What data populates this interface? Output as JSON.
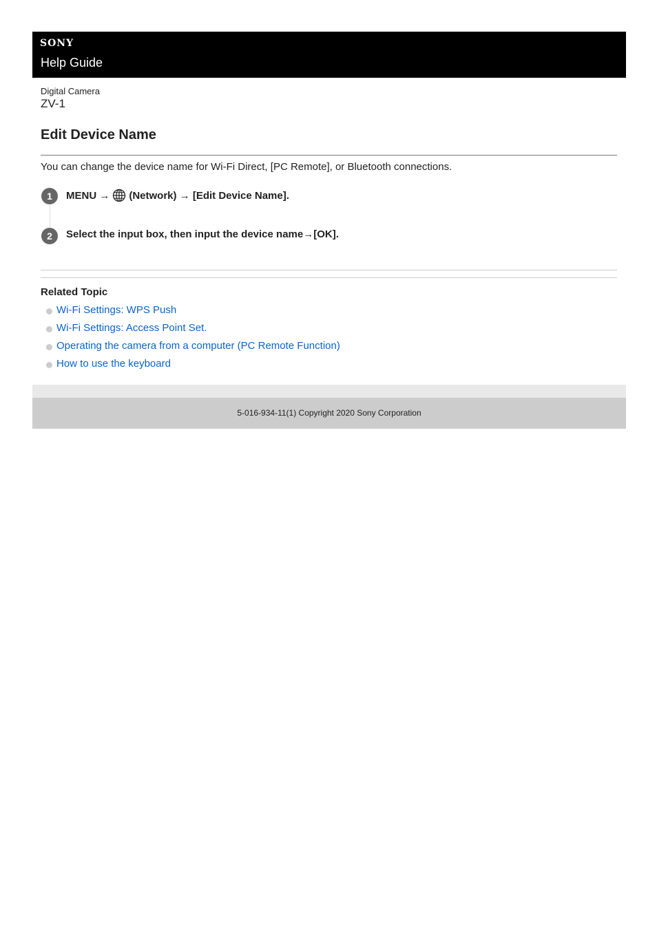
{
  "header": {
    "brand": "SONY",
    "guide_label": "Help Guide"
  },
  "product": {
    "type": "Digital Camera",
    "model": "ZV-1"
  },
  "article": {
    "title": "Edit Device Name",
    "intro": "You can change the device name for Wi-Fi Direct, [PC Remote], or Bluetooth connections.",
    "steps": [
      {
        "number": "1",
        "text_before_icon": "MENU →",
        "icon": "network-globe-icon",
        "text_after_icon": "(Network) → [Edit Device Name]."
      },
      {
        "number": "2",
        "text": "Select the input box, then input the device name→[OK]."
      }
    ]
  },
  "related": {
    "title": "Related Topic",
    "links": [
      {
        "label": "Wi-Fi Settings: WPS Push"
      },
      {
        "label": "Wi-Fi Settings: Access Point Set."
      },
      {
        "label": "Operating the camera from a computer (PC Remote Function)"
      },
      {
        "label": "How to use the keyboard"
      }
    ]
  },
  "footer": {
    "copyright": "5-016-934-11(1) Copyright 2020 Sony Corporation"
  },
  "colors": {
    "header_bg": "#000000",
    "link": "#0a64c8",
    "step_badge": "#666666",
    "footer_bg": "#cccccc"
  }
}
